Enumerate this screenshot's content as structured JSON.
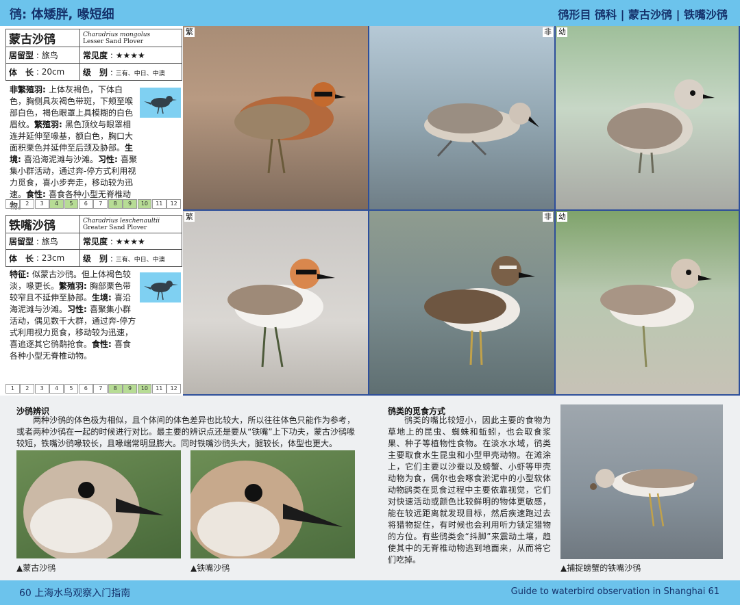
{
  "header": {
    "left_title": "鸻: 体矮胖, 喙短细",
    "right_path": "鸻形目  鸻科  |  蒙古沙鸻  |  铁嘴沙鸻"
  },
  "species": [
    {
      "name": "蒙古沙鸻",
      "latin": "Charadrius mongolus",
      "english": "Lesser Sand Plover",
      "residency_label": "居留型",
      "residency": "旅鸟",
      "frequency_label": "常见度",
      "frequency": "★★★★",
      "length_label": "体　长",
      "length": "20cm",
      "level_label": "级　别",
      "level": "三有、中日、中澳",
      "description": [
        {
          "b": "非繁殖羽: ",
          "t": "上体灰褐色，下体白色，胸侧具灰褐色带斑，下颊至喉部白色，褐色眼罩上具模糊的白色眉纹。"
        },
        {
          "b": "繁殖羽: ",
          "t": "黑色顶纹与眼罩相连并延伸至喙基，额白色，胸口大面积栗色并延伸至后颈及胁部。"
        },
        {
          "b": "生境: ",
          "t": "喜沿海泥滩与沙滩。"
        },
        {
          "b": "习性: ",
          "t": "喜聚集小群活动，通过奔-停方式利用视力觅食，喜小步奔走，移动较为迅速。"
        },
        {
          "b": "食性: ",
          "t": "喜食各种小型无脊椎动物。"
        }
      ],
      "months": [
        "1",
        "2",
        "3",
        "4",
        "5",
        "6",
        "7",
        "8",
        "9",
        "10",
        "11",
        "12"
      ],
      "active_months": [
        4,
        5,
        8,
        9,
        10
      ],
      "photo_tags": [
        "繁",
        "非",
        "幼"
      ]
    },
    {
      "name": "铁嘴沙鸻",
      "latin": "Charadrius leschenaultii",
      "english": "Greater Sand Plover",
      "residency_label": "居留型",
      "residency": "旅鸟",
      "frequency_label": "常见度",
      "frequency": "★★★★",
      "length_label": "体　长",
      "length": "23cm",
      "level_label": "级　别",
      "level": "三有、中日、中澳",
      "description": [
        {
          "b": "特征: ",
          "t": "似蒙古沙鸻。但上体褐色较淡，喙更长。"
        },
        {
          "b": "繁殖羽: ",
          "t": "胸部栗色带较窄且不延伸至胁部。"
        },
        {
          "b": "生境: ",
          "t": "喜沿海泥滩与沙滩。"
        },
        {
          "b": "习性: ",
          "t": "喜聚集小群活动，偶见数千大群，通过奔-停方式利用视力觅食，移动较为迅速，喜追逐其它鸻鹬抢食。"
        },
        {
          "b": "食性: ",
          "t": "喜食各种小型无脊椎动物。"
        }
      ],
      "months": [
        "1",
        "2",
        "3",
        "4",
        "5",
        "6",
        "7",
        "8",
        "9",
        "10",
        "11",
        "12"
      ],
      "active_months": [
        8,
        9,
        10
      ],
      "photo_tags": [
        "繁",
        "非",
        "幼"
      ]
    }
  ],
  "identify": {
    "title": "沙鸻辨识",
    "text": "两种沙鸻的体色极为相似，且个体间的体色差异也比较大，所以往往体色只能作为参考，或者两种沙鸻在一起的时候进行对比。最主要的辨识点还是要从“铁嘴”上下功夫，蒙古沙鸻喙较短，铁嘴沙鸻喙较长，且喙端常明显膨大。同时铁嘴沙鸻头大，腿较长，体型也更大。",
    "caption1": "▲蒙古沙鸻",
    "caption2": "▲铁嘴沙鸻"
  },
  "foraging": {
    "title": "鸻类的觅食方式",
    "text1": "鸻类的嘴比较短小，因此主要的食物为草地上的昆虫、蜘蛛和蚯蚓，也会取食浆果、种子等植物性食物。在淡水水域，鸻类主要取食水生昆虫和小型甲壳动物。在滩涂上，它们主要以沙蚕以及螃蟹、小虾等甲壳动物为食，偶尔也会啄食淤泥中的小型软体动物。",
    "text2": "鸻类在觅食过程中主要依靠视觉，它们对快速活动或颜色比较鲜明的物体更敏感，能在较远距离就发现目标，然后疾速跑过去将猎物捉住，有时候也会利用听力锁定猎物的方位。有些鸻类会“抖脚”来震动土壤，趋使其中的无脊椎动物逃到地面来，从而将它们吃掉。",
    "caption": "▲捕捉螃蟹的铁嘴沙鸻"
  },
  "footer": {
    "left": "60  上海水鸟观察入门指南",
    "right": "Guide to waterbird observation in Shanghai   61"
  },
  "colors": {
    "bar": "#6cc3ec",
    "month_active": "#b7dc95",
    "frame": "#2d4e9a"
  }
}
